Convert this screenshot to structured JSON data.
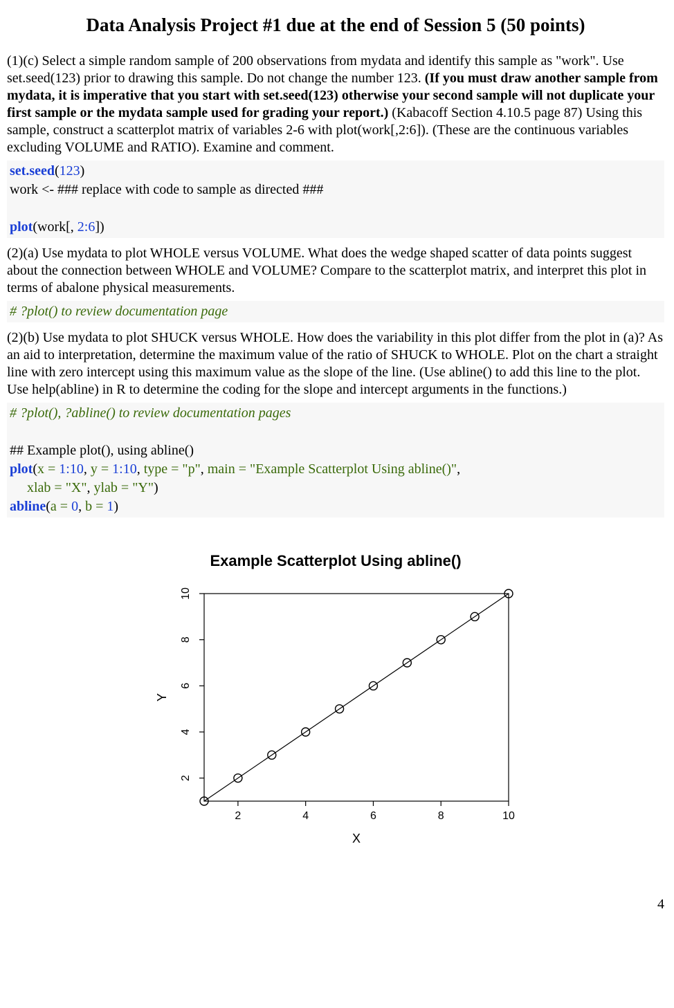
{
  "title": "Data Analysis Project #1 due at the end of Session 5 (50 points)",
  "para_1c_a": " (1)(c) Select a simple random sample of 200 observations from mydata and identify this sample as \"work\". Use set.seed(123) prior to drawing this sample. Do not change the number 123. ",
  "para_1c_bold": "(If you must draw another sample from mydata, it is imperative that you start with set.seed(123) otherwise your second sample will not duplicate your first sample or the mydata sample used for grading your report.)",
  "para_1c_b": " (Kabacoff Section 4.10.5 page 87) Using this sample, construct a scatterplot matrix of variables 2-6 with plot(work[,2:6]). (These are the continuous variables excluding VOLUME and RATIO). Examine and comment.",
  "code1": {
    "fn1": "set.seed",
    "open1": "(",
    "num1": "123",
    "close1": ")",
    "line2": "work <- ### replace with code to sample as directed ###",
    "fn2": "plot",
    "inner2a": "(work[, ",
    "num2a": "2",
    "colon": ":",
    "num2b": "6",
    "inner2b": "])"
  },
  "para_2a": "(2)(a) Use mydata to plot WHOLE versus VOLUME. What does the wedge shaped scatter of data points suggest about the connection between WHOLE and VOLUME? Compare to the scatterplot matrix, and interpret this plot in terms of abalone physical measurements.",
  "code2_comment": "# ?plot() to review documentation page",
  "para_2b": "(2)(b) Use mydata to plot SHUCK versus WHOLE. How does the variability in this plot differ from the plot in (a)? As an aid to interpretation, determine the maximum value of the ratio of SHUCK to WHOLE. Plot on the chart a straight line with zero intercept using this maximum value as the slope of the line. (Use abline() to add this line to the plot. Use help(abline) in R to determine the coding for the slope and intercept arguments in the functions.)",
  "code3": {
    "comment": "# ?plot(), ?abline() to review documentation pages",
    "line2": "## Example plot(), using abline()",
    "plot_fn": "plot",
    "x_arg": "x = ",
    "one": "1",
    "colon": ":",
    "ten": "10",
    "sep": ", ",
    "y_arg": "y = ",
    "type_arg": "type = ",
    "p_str": "\"p\"",
    "main_arg": "main = ",
    "main_str": "\"Example Scatterplot Using abline()\"",
    "indent": "     ",
    "xlab_arg": "xlab = ",
    "x_str": "\"X\"",
    "ylab_arg": "ylab = ",
    "y_str": "\"Y\"",
    "close": ")",
    "abline_fn": "abline",
    "a_arg": "a = ",
    "zero": "0",
    "b_arg": "b = ",
    "one2": "1"
  },
  "chart_data": {
    "type": "scatter",
    "title": "Example Scatterplot Using abline()",
    "xlabel": "X",
    "ylabel": "Y",
    "x": [
      1,
      2,
      3,
      4,
      5,
      6,
      7,
      8,
      9,
      10
    ],
    "y": [
      1,
      2,
      3,
      4,
      5,
      6,
      7,
      8,
      9,
      10
    ],
    "xlim": [
      1,
      10
    ],
    "ylim": [
      1,
      10
    ],
    "xticks": [
      2,
      4,
      6,
      8,
      10
    ],
    "yticks": [
      2,
      4,
      6,
      8,
      10
    ],
    "abline": {
      "intercept": 0,
      "slope": 1
    }
  },
  "pagenum": "4"
}
